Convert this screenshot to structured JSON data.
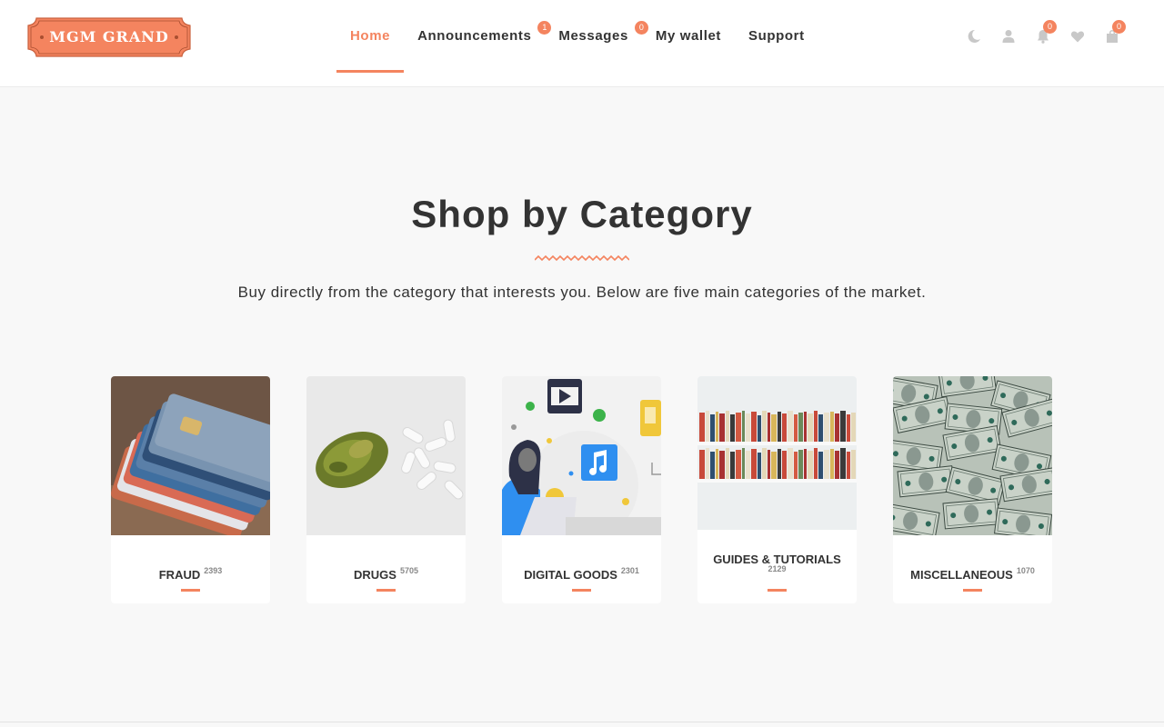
{
  "header": {
    "logo_text": "MGM GRAND",
    "nav": [
      {
        "label": "Home",
        "active": true,
        "badge": null
      },
      {
        "label": "Announcements",
        "active": false,
        "badge": "1"
      },
      {
        "label": "Messages",
        "active": false,
        "badge": "0"
      },
      {
        "label": "My wallet",
        "active": false,
        "badge": null
      },
      {
        "label": "Support",
        "active": false,
        "badge": null
      }
    ],
    "icons": [
      {
        "name": "moon-icon",
        "badge": null
      },
      {
        "name": "user-icon",
        "badge": null
      },
      {
        "name": "bell-icon",
        "badge": "0"
      },
      {
        "name": "heart-icon",
        "badge": null
      },
      {
        "name": "bag-icon",
        "badge": "0"
      }
    ]
  },
  "main": {
    "title": "Shop by Category",
    "subtitle": "Buy directly from the category that interests you. Below are five main categories of the market."
  },
  "categories": [
    {
      "label": "FRAUD",
      "count": "2393",
      "image": "credit-cards"
    },
    {
      "label": "DRUGS",
      "count": "5705",
      "image": "cannabis-and-pills"
    },
    {
      "label": "DIGITAL GOODS",
      "count": "2301",
      "image": "digital-media-illustration"
    },
    {
      "label": "GUIDES & TUTORIALS",
      "count": "2129",
      "image": "bookshelf"
    },
    {
      "label": "MISCELLANEOUS",
      "count": "1070",
      "image": "banknotes"
    }
  ],
  "colors": {
    "accent": "#f4845f",
    "text": "#333333",
    "background": "#f8f8f8"
  }
}
